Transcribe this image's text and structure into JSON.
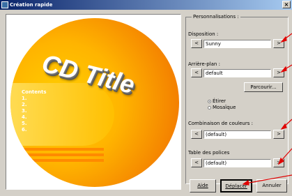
{
  "window": {
    "title": "Création rapide"
  },
  "preview": {
    "cd_title": "CD Title",
    "contents_label": "Contents",
    "track_numbers": [
      "1.",
      "2.",
      "3.",
      "4.",
      "5.",
      "6."
    ]
  },
  "panel": {
    "group_title": "Personnalisations :",
    "disposition": {
      "label": "Disposition :",
      "value": "Sunny"
    },
    "background": {
      "label": "Arrière-plan :",
      "value": "default",
      "browse": "Parcourir..."
    },
    "stretch": {
      "option1": "Étirer",
      "option2": "Mosaïque",
      "selected": "option1"
    },
    "colors": {
      "label": "Combinaison de couleurs :",
      "value": "(default)"
    },
    "fonts": {
      "label": "Table des polices",
      "value": "(default)"
    },
    "prev": "<",
    "next": ">"
  },
  "buttons": {
    "help": "Aide",
    "move": "Déplacer",
    "cancel": "Annuler"
  },
  "icons": {
    "title_icon": "app-icon",
    "close": "×"
  },
  "colors": {
    "titlebar_start": "#0a246a",
    "titlebar_end": "#a6caf0",
    "disc_orange": "#f08a00",
    "disc_yellow": "#ffd000",
    "arrow_red": "#e00000"
  }
}
